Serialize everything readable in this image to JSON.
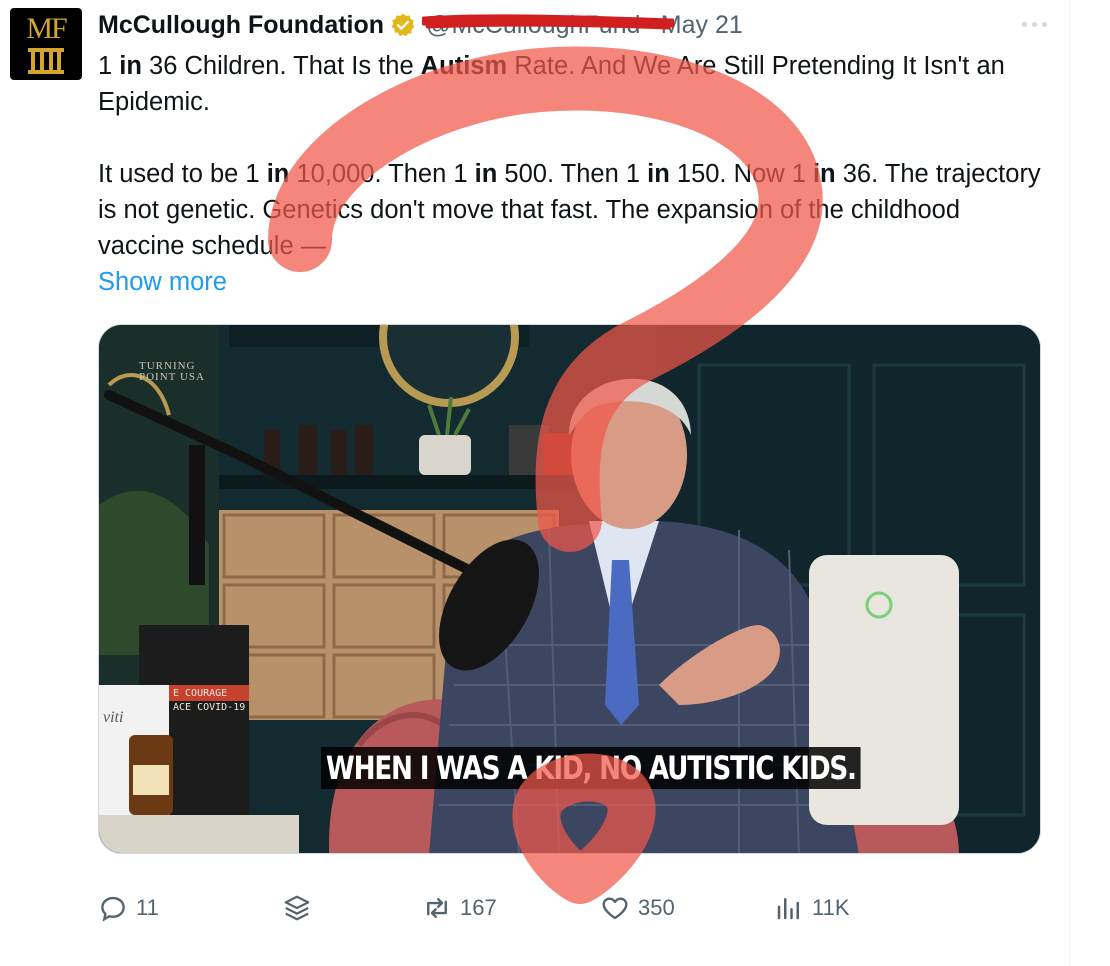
{
  "tweet": {
    "display_name": "McCullough Foundation",
    "handle": "@McCulloughFund",
    "separator": "·",
    "date": "May 21",
    "avatar_text": "MF",
    "text_line_1_parts": [
      "1 ",
      "in",
      " 36 Children. That Is the ",
      "Autism",
      " Rate. And We Are Still Pretending It Isn't an Epidemic."
    ],
    "text_line_2_parts": [
      "It used to be 1 ",
      "in",
      " 10,000. Then 1 ",
      "in",
      " 500. Then 1 ",
      "in",
      " 150. Now 1 ",
      "in",
      " 36. The trajectory is not genetic. Genetics don't move that fast. The expansion of the childhood vaccine schedule —"
    ],
    "show_more": "Show more"
  },
  "media": {
    "brand_line_1": "TURNING",
    "brand_line_2": "POINT USA",
    "book_title_1": "E COURAGE",
    "book_title_2": "ACE COVID-19",
    "box_text": "viti",
    "caption": "WHEN I WAS A KID, NO AUTISTIC KIDS."
  },
  "actions": {
    "replies": "11",
    "reposts": "167",
    "likes": "350",
    "views": "11K"
  },
  "colors": {
    "accent": "#1d9bf0",
    "muted": "#536471",
    "verified_gold": "#e2b719",
    "overlay_red": "#f0574a"
  },
  "icons": [
    "reply-icon",
    "stack-icon",
    "repost-icon",
    "like-icon",
    "views-icon",
    "verified-badge-icon",
    "more-icon"
  ]
}
